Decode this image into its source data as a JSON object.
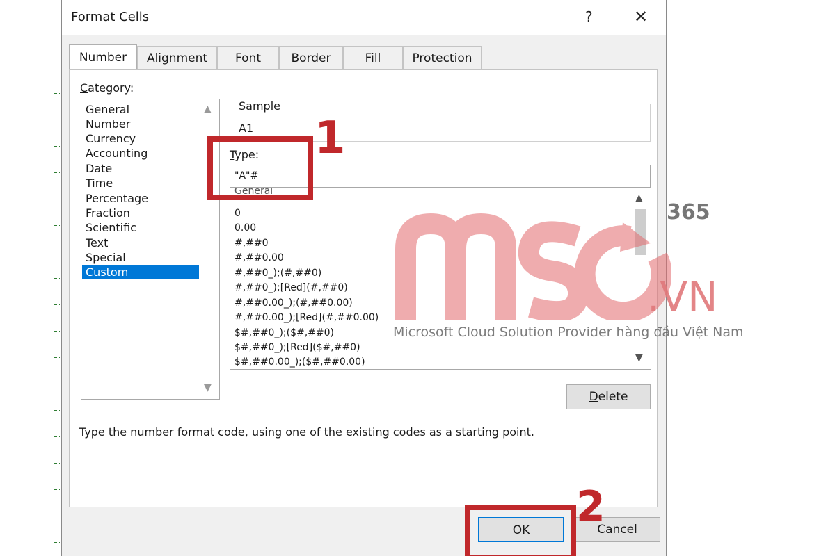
{
  "dialog": {
    "title": "Format Cells",
    "help": "?",
    "close": "✕"
  },
  "tabs": [
    {
      "label": "Number",
      "active": true
    },
    {
      "label": "Alignment"
    },
    {
      "label": "Font"
    },
    {
      "label": "Border"
    },
    {
      "label": "Fill"
    },
    {
      "label": "Protection"
    }
  ],
  "category": {
    "label_prefix": "C",
    "label_rest": "ategory:",
    "items": [
      "General",
      "Number",
      "Currency",
      "Accounting",
      "Date",
      "Time",
      "Percentage",
      "Fraction",
      "Scientific",
      "Text",
      "Special",
      "Custom"
    ],
    "selected": "Custom"
  },
  "sample": {
    "label": "Sample",
    "value": "A1"
  },
  "type": {
    "label_prefix": "T",
    "label_rest": "ype:",
    "value": "\"A\"#"
  },
  "formats": [
    "General",
    "0",
    "0.00",
    "#,##0",
    "#,##0.00",
    "#,##0_);(#,##0)",
    "#,##0_);[Red](#,##0)",
    "#,##0.00_);(#,##0.00)",
    "#,##0.00_);[Red](#,##0.00)",
    "$#,##0_);($#,##0)",
    "$#,##0_);[Red]($#,##0)",
    "$#,##0.00_);($#,##0.00)"
  ],
  "buttons": {
    "delete_prefix": "D",
    "delete_rest": "elete",
    "ok": "OK",
    "cancel": "Cancel"
  },
  "hint": "Type the number format code, using one of the existing codes as a starting point.",
  "annotations": {
    "step1": "1",
    "step2": "2",
    "color": "#c0282b"
  },
  "watermark": {
    "brand": "365",
    "domain": ".VN",
    "tagline": "Microsoft Cloud Solution Provider hàng đầu Việt Nam"
  }
}
